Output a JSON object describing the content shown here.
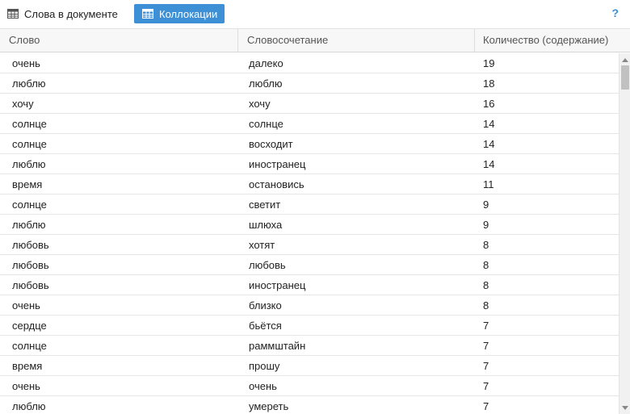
{
  "toolbar": {
    "tabs": [
      {
        "label": "Слова в документе",
        "icon": "table-icon",
        "active": false
      },
      {
        "label": "Коллокации",
        "icon": "table-icon",
        "active": true
      }
    ],
    "help_label": "?",
    "accent_color": "#3d8fd6"
  },
  "table": {
    "columns": [
      "Слово",
      "Словосочетание",
      "Количество (содержание)"
    ],
    "rows": [
      {
        "word": "очень",
        "phrase": "далеко",
        "count": "19"
      },
      {
        "word": "люблю",
        "phrase": "люблю",
        "count": "18"
      },
      {
        "word": "хочу",
        "phrase": "хочу",
        "count": "16"
      },
      {
        "word": "солнце",
        "phrase": "солнце",
        "count": "14"
      },
      {
        "word": "солнце",
        "phrase": "восходит",
        "count": "14"
      },
      {
        "word": "люблю",
        "phrase": "иностранец",
        "count": "14"
      },
      {
        "word": "время",
        "phrase": "остановись",
        "count": "11"
      },
      {
        "word": "солнце",
        "phrase": "светит",
        "count": "9"
      },
      {
        "word": "люблю",
        "phrase": "шлюха",
        "count": "9"
      },
      {
        "word": "любовь",
        "phrase": "хотят",
        "count": "8"
      },
      {
        "word": "любовь",
        "phrase": "любовь",
        "count": "8"
      },
      {
        "word": "любовь",
        "phrase": "иностранец",
        "count": "8"
      },
      {
        "word": "очень",
        "phrase": "близко",
        "count": "8"
      },
      {
        "word": "сердце",
        "phrase": "бьётся",
        "count": "7"
      },
      {
        "word": "солнце",
        "phrase": "раммштайн",
        "count": "7"
      },
      {
        "word": "время",
        "phrase": "прошу",
        "count": "7"
      },
      {
        "word": "очень",
        "phrase": "очень",
        "count": "7"
      },
      {
        "word": "люблю",
        "phrase": "умереть",
        "count": "7"
      }
    ]
  }
}
